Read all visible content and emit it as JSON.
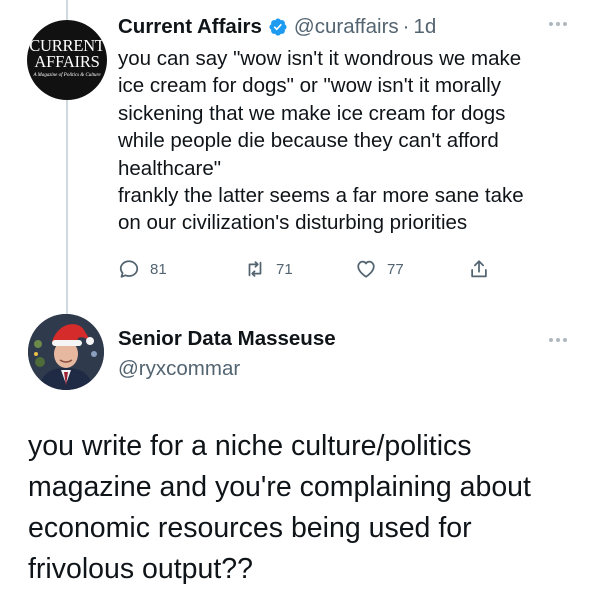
{
  "tweet1": {
    "avatar_text": {
      "line1": "CURRENT",
      "line2": "AFFAIRS",
      "tagline": "A Magazine of Politics & Culture"
    },
    "display_name": "Current Affairs",
    "handle": "@curaffairs",
    "separator": "·",
    "time": "1d",
    "text": "you can say \"wow isn't it wondrous we make\nice cream for dogs\" or \"wow isn't it morally\nsickening that we make ice cream for dogs\nwhile people die because they can't afford\nhealthcare\"\nfrankly the latter seems a far more sane take\non our civilization's disturbing priorities",
    "stats": {
      "replies": "81",
      "retweets": "71",
      "likes": "77"
    }
  },
  "tweet2": {
    "display_name": "Senior Data Masseuse",
    "handle": "@ryxcommar",
    "text": "you write for a niche culture/politics\nmagazine and you're complaining about\neconomic resources being used for\nfrivolous output??"
  },
  "colors": {
    "text": "#0f1419",
    "secondary": "#536471",
    "verified": "#1d9bf0",
    "thread_line": "#cfd9de"
  }
}
